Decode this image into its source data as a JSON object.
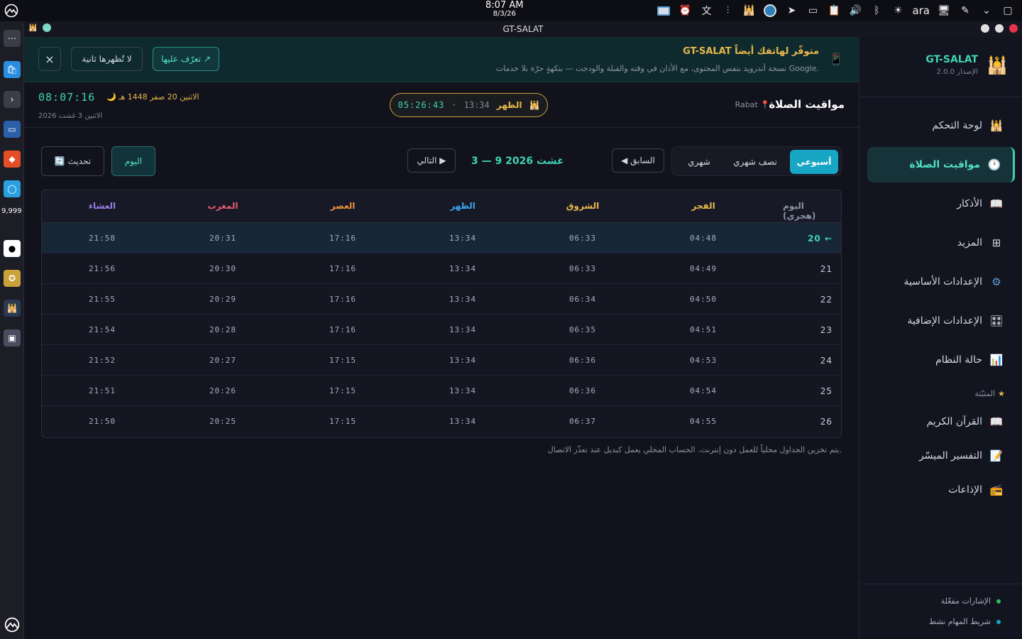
{
  "system": {
    "time": "8:07 AM",
    "date": "8/3/26",
    "lang": "ara"
  },
  "dock": {
    "badge": "9,999"
  },
  "window": {
    "title": "GT-SALAT"
  },
  "sidebar": {
    "app_name": "GT-SALAT",
    "version": "الإصدار 2.0.0",
    "items": [
      {
        "label": "لوحة التحكم",
        "icon": "🕌"
      },
      {
        "label": "مواقيت الصلاة",
        "icon": "🕐"
      },
      {
        "label": "الأذكار",
        "icon": "📖"
      },
      {
        "label": "المزيد",
        "icon": "⊞"
      },
      {
        "label": "الإعدادات الأساسية",
        "icon": "⚙"
      },
      {
        "label": "الإعدادات الإضافية",
        "icon": "🎛"
      },
      {
        "label": "حالة النظام",
        "icon": "📊"
      }
    ],
    "favorites_label": "المثبّتة",
    "favorites": [
      {
        "label": "القرآن الكريم",
        "icon": "📖"
      },
      {
        "label": "التفسير الميسّر",
        "icon": "📝"
      },
      {
        "label": "الإذاعات",
        "icon": "📻"
      }
    ],
    "status": [
      {
        "label": "الإشارات مفعّلة",
        "color": "#2fbf5a"
      },
      {
        "label": "شريط المهام نشط",
        "color": "#17a6c4"
      }
    ]
  },
  "banner": {
    "title": "GT-SALAT متوفّر لهاتفك أيضاً",
    "subtitle": "نسخة أندرويد بنفس المحتوى، مع الأذان في وقته والقبلة والودجت — بنكهةٍ حرّة بلا خدمات Google.",
    "learn_label": "تعرّف عليها ↗",
    "dismiss_label": "لا تُظهرها ثانية",
    "close_label": "×"
  },
  "header": {
    "clock": "08:07:16",
    "hijri": "🌙 الاثنين 20 صفر 1448 هـ",
    "gregorian": "الاثنين 3 غشت 2026",
    "next_prayer": {
      "name": "الظهر",
      "time": "13:34",
      "countdown": "05:26:43",
      "sep": "·"
    },
    "title": "مواقيت الصلاة",
    "city": "Rabat 📍"
  },
  "controls": {
    "tabs": [
      "أسبوعي",
      "نصف شهري",
      "شهري"
    ],
    "prev_label": "◀ السابق",
    "range": "3 — 9 غشت 2026",
    "next_label": "التالي ▶",
    "today_label": "اليوم",
    "refresh_label": "🔄 تحديث"
  },
  "table": {
    "headers": [
      "اليوم (هجري)",
      "الفجر",
      "الشروق",
      "الظهر",
      "العصر",
      "المغرب",
      "العشاء"
    ],
    "header_colors": [
      "#8b92a3",
      "#e8b74a",
      "#e8b74a",
      "#3aa3e8",
      "#e8913a",
      "#e85a6e",
      "#9a7ae8"
    ],
    "rows": [
      {
        "day": "20 ←",
        "times": [
          "04:48",
          "06:33",
          "13:34",
          "17:16",
          "20:31",
          "21:58"
        ],
        "today": true
      },
      {
        "day": "21",
        "times": [
          "04:49",
          "06:33",
          "13:34",
          "17:16",
          "20:30",
          "21:56"
        ]
      },
      {
        "day": "22",
        "times": [
          "04:50",
          "06:34",
          "13:34",
          "17:16",
          "20:29",
          "21:55"
        ]
      },
      {
        "day": "23",
        "times": [
          "04:51",
          "06:35",
          "13:34",
          "17:16",
          "20:28",
          "21:54"
        ]
      },
      {
        "day": "24",
        "times": [
          "04:53",
          "06:36",
          "13:34",
          "17:15",
          "20:27",
          "21:52"
        ]
      },
      {
        "day": "25",
        "times": [
          "04:54",
          "06:36",
          "13:34",
          "17:15",
          "20:26",
          "21:51"
        ]
      },
      {
        "day": "26",
        "times": [
          "04:55",
          "06:37",
          "13:34",
          "17:15",
          "20:25",
          "21:50"
        ]
      }
    ]
  },
  "note": "يتم تخزين الجداول محلياً للعمل دون إنترنت. الحساب المحلي يعمل كبديل عند تعذّر الاتصال."
}
